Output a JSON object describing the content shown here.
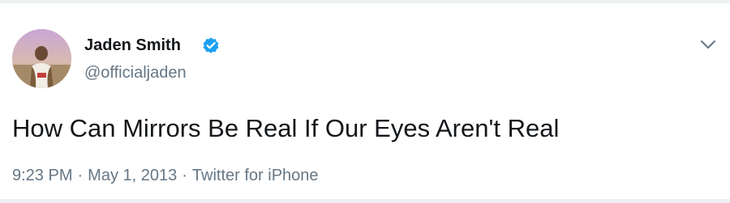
{
  "tweet": {
    "author": {
      "display_name": "Jaden Smith",
      "handle": "@officialjaden",
      "verified": true,
      "avatar_icon": "profile-photo"
    },
    "text": "How Can Mirrors Be Real If Our Eyes Aren't Real",
    "time": "9:23 PM",
    "date": "May 1, 2013",
    "source": "Twitter for iPhone",
    "separator": "·"
  },
  "icons": {
    "verified": "verified-badge-icon",
    "menu": "chevron-down-icon"
  },
  "colors": {
    "verified_blue": "#1da1f2",
    "text_primary": "#14171a",
    "text_secondary": "#657786",
    "border": "#eef1f3"
  }
}
